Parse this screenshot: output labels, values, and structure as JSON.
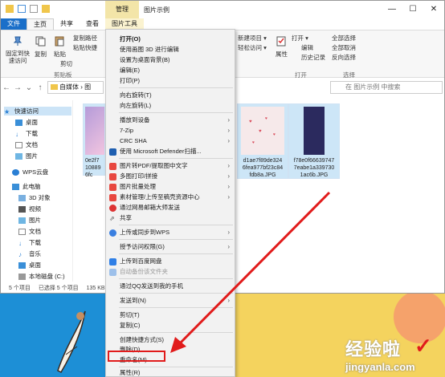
{
  "window": {
    "manage_tab": "管理",
    "title": "图片示例",
    "min": "—",
    "max": "☐",
    "close": "✕"
  },
  "tabs": [
    "文件",
    "主页",
    "共享",
    "查看",
    "图片工具"
  ],
  "ribbon": {
    "pin": "固定到快\n速访问",
    "copy": "复制",
    "paste": "粘贴",
    "copy_path": "复制路径",
    "paste_shortcut": "粘贴快捷",
    "cut": "剪切",
    "clipboard_group": "剪贴板",
    "new_item": "新建项目 ▾",
    "easy_access": "轻松访问 ▾",
    "properties": "属性",
    "open": "打开 ▾",
    "edit": "编辑",
    "history": "历史记录",
    "open_group": "打开",
    "select_all": "全部选择",
    "select_none": "全部取消",
    "invert": "反向选择",
    "select_group": "选择"
  },
  "address": {
    "path": "自媒体 › 图",
    "search_placeholder": "在 图片示例 中搜索"
  },
  "navpane": [
    "快速访问",
    "桌面",
    "下载",
    "文档",
    "图片",
    "WPS云盘",
    "此电脑",
    "3D 对象",
    "视频",
    "图片",
    "文档",
    "下载",
    "音乐",
    "桌面",
    "本地磁盘 (C:)"
  ],
  "files": [
    {
      "line1": "0e2f7",
      "line2": "10889",
      "line3": "6fc"
    },
    {
      "line1": "d1ae7f89de324",
      "line2": "6fea977bf23c84",
      "line3": "fdb8a.JPG"
    },
    {
      "line1": "f78e0f66639747",
      "line2": "7eabe1a339730",
      "line3": "1ac6b.JPG"
    }
  ],
  "status": {
    "count": "5 个项目",
    "selected": "已选择 5 个项目",
    "size": "135 KB"
  },
  "menu": [
    {
      "label": "打开(O)",
      "bold": true
    },
    {
      "label": "使用画图 3D 进行编辑"
    },
    {
      "label": "设置为桌面背景(B)"
    },
    {
      "label": "编辑(E)"
    },
    {
      "label": "打印(P)"
    },
    {
      "label": "向右旋转(T)"
    },
    {
      "label": "向左旋转(L)"
    },
    {
      "label": "播放到设备",
      "arrow": true
    },
    {
      "label": "7-Zip",
      "arrow": true
    },
    {
      "label": "CRC SHA",
      "arrow": true
    },
    {
      "label": "使用 Microsoft Defender扫描..."
    },
    {
      "label": "图片转PDF/提取图中文字",
      "arrow": true
    },
    {
      "label": "多图打印/拼接",
      "arrow": true
    },
    {
      "label": "图片批量处理",
      "arrow": true
    },
    {
      "label": "素材管理/上传至稿壳资源中心",
      "arrow": true
    },
    {
      "label": "通过网易邮箱大师发送"
    },
    {
      "label": "共享"
    },
    {
      "label": "上传或同步到WPS",
      "arrow": true
    },
    {
      "label": "授予访问权限(G)",
      "arrow": true
    },
    {
      "label": "上传到百度网盘"
    },
    {
      "label": "自动备份该文件夹"
    },
    {
      "label": "通过QQ发送到我的手机"
    },
    {
      "label": "发送到(N)",
      "arrow": true
    },
    {
      "label": "剪切(T)"
    },
    {
      "label": "复制(C)"
    },
    {
      "label": "创建快捷方式(S)"
    },
    {
      "label": "删除(D)"
    },
    {
      "label": "重命名(M)"
    },
    {
      "label": "属性(R)"
    }
  ],
  "watermark": {
    "cn": "经验啦",
    "check": "✓",
    "url": "jingyanla.com"
  },
  "colors": {
    "accent_red": "#e11b1b",
    "file_tab": "#1a6fc9",
    "tool_tab": "#f3e5a8"
  }
}
